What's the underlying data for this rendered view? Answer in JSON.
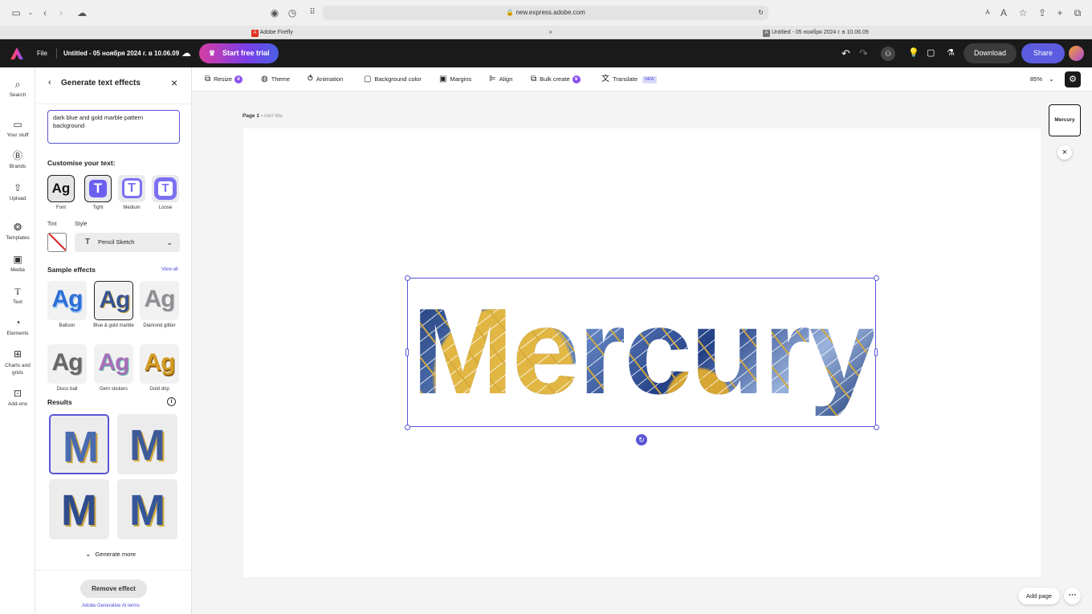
{
  "browser": {
    "url": "new.express.adobe.com",
    "tabs": [
      {
        "label": "Adobe Firefly",
        "icon": "adobe-icon"
      },
      {
        "label": "Untitled - 05 ноября 2024 г. в 10.06.09",
        "icon": "express-icon"
      }
    ],
    "reader_small": "A",
    "reader_large": "A"
  },
  "app": {
    "file_menu": "File",
    "doc_title": "Untitled - 05 ноября 2024 г. в 10.06.09",
    "trial_label": "Start free trial",
    "download_label": "Download",
    "share_label": "Share",
    "accent": "#5c5ce0"
  },
  "rail": [
    {
      "label": "Search",
      "icon": "search-icon"
    },
    {
      "label": "Your stuff",
      "icon": "folder-icon"
    },
    {
      "label": "Brands",
      "icon": "brand-icon"
    },
    {
      "label": "Upload",
      "icon": "upload-icon"
    },
    {
      "label": "Templates",
      "icon": "templates-icon"
    },
    {
      "label": "Media",
      "icon": "media-icon"
    },
    {
      "label": "Text",
      "icon": "text-icon"
    },
    {
      "label": "Elements",
      "icon": "elements-icon"
    },
    {
      "label": "Charts and grids",
      "icon": "charts-icon"
    },
    {
      "label": "Add-ons",
      "icon": "addons-icon"
    }
  ],
  "panel": {
    "title": "Generate text effects",
    "prompt": "dark blue and gold marble pattern background",
    "customise_label": "Customise your text:",
    "fit_options": [
      "Font",
      "Tight",
      "Medium",
      "Loose"
    ],
    "tint_label": "Tint",
    "style_label": "Style",
    "style_value": "Pencil Sketch",
    "sample_label": "Sample effects",
    "view_all": "View all",
    "samples": [
      {
        "label": "Balloon",
        "glyph": "Ag"
      },
      {
        "label": "Blue & gold marble",
        "glyph": "Ag"
      },
      {
        "label": "Diamond glitter",
        "glyph": "Ag"
      },
      {
        "label": "Disco ball",
        "glyph": "Ag"
      },
      {
        "label": "Gem stickers",
        "glyph": "Ag"
      },
      {
        "label": "Gold drip",
        "glyph": "Ag"
      }
    ],
    "results_label": "Results",
    "result_glyph": "M",
    "generate_more": "Generate more",
    "remove_effect": "Remove effect",
    "terms": "Adobe Generative AI terms",
    "font_glyph": "Ag",
    "t_glyph": "T"
  },
  "toolbar": {
    "items": [
      "Resize",
      "Theme",
      "Animation",
      "Background color",
      "Margins",
      "Align",
      "Bulk create",
      "Translate"
    ],
    "new_badge": "NEW",
    "zoom": "85%"
  },
  "canvas": {
    "page_label": "Page 1 -",
    "add_title": "Add title",
    "text": "Mercury",
    "thumb_label": "Mercury",
    "add_page": "Add page"
  }
}
